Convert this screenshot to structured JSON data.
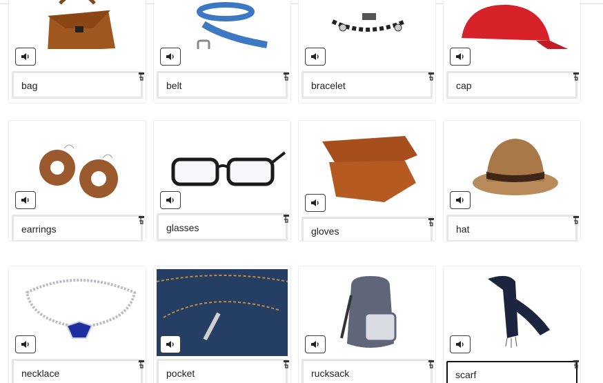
{
  "cards": [
    {
      "word": "bag",
      "image": "bag-photo"
    },
    {
      "word": "belt",
      "image": "belt-photo"
    },
    {
      "word": "bracelet",
      "image": "bracelet-photo"
    },
    {
      "word": "cap",
      "image": "cap-photo"
    },
    {
      "word": "earrings",
      "image": "earrings-photo"
    },
    {
      "word": "glasses",
      "image": "glasses-photo"
    },
    {
      "word": "gloves",
      "image": "gloves-photo"
    },
    {
      "word": "hat",
      "image": "hat-photo"
    },
    {
      "word": "necklace",
      "image": "necklace-photo"
    },
    {
      "word": "pocket",
      "image": "pocket-photo"
    },
    {
      "word": "rucksack",
      "image": "rucksack-photo"
    },
    {
      "word": "scarf",
      "image": "scarf-photo"
    }
  ],
  "icons": {
    "sound": "speaker-icon",
    "hint": "pointing-hand-icon"
  },
  "colors": {
    "active_border": "#111111",
    "inactive_border": "#e6e6e6"
  }
}
